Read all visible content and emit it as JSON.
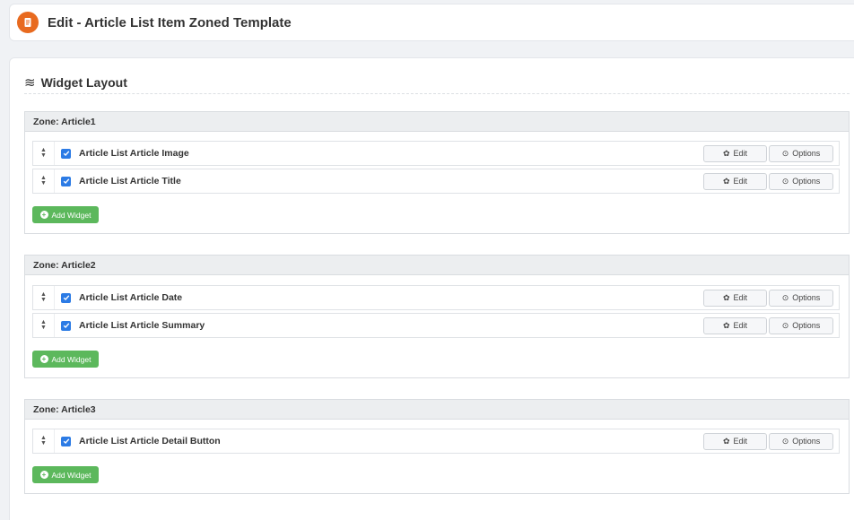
{
  "header": {
    "title": "Edit - Article List Item Zoned Template",
    "icon": "document-icon",
    "icon_color": "#e86a1f"
  },
  "layout": {
    "section_title": "Widget Layout",
    "section_icon": "≋"
  },
  "buttons": {
    "edit_label": "Edit",
    "options_label": "Options",
    "add_widget_label": "Add Widget",
    "add_widget_color": "#5cb85c"
  },
  "zones": [
    {
      "title": "Zone: Article1",
      "widgets": [
        {
          "label": "Article List Article Image",
          "checked": true
        },
        {
          "label": "Article List Article Title",
          "checked": true
        }
      ]
    },
    {
      "title": "Zone: Article2",
      "widgets": [
        {
          "label": "Article List Article Date",
          "checked": true
        },
        {
          "label": "Article List Article Summary",
          "checked": true
        }
      ]
    },
    {
      "title": "Zone: Article3",
      "widgets": [
        {
          "label": "Article List Article Detail Button",
          "checked": true
        }
      ]
    }
  ]
}
